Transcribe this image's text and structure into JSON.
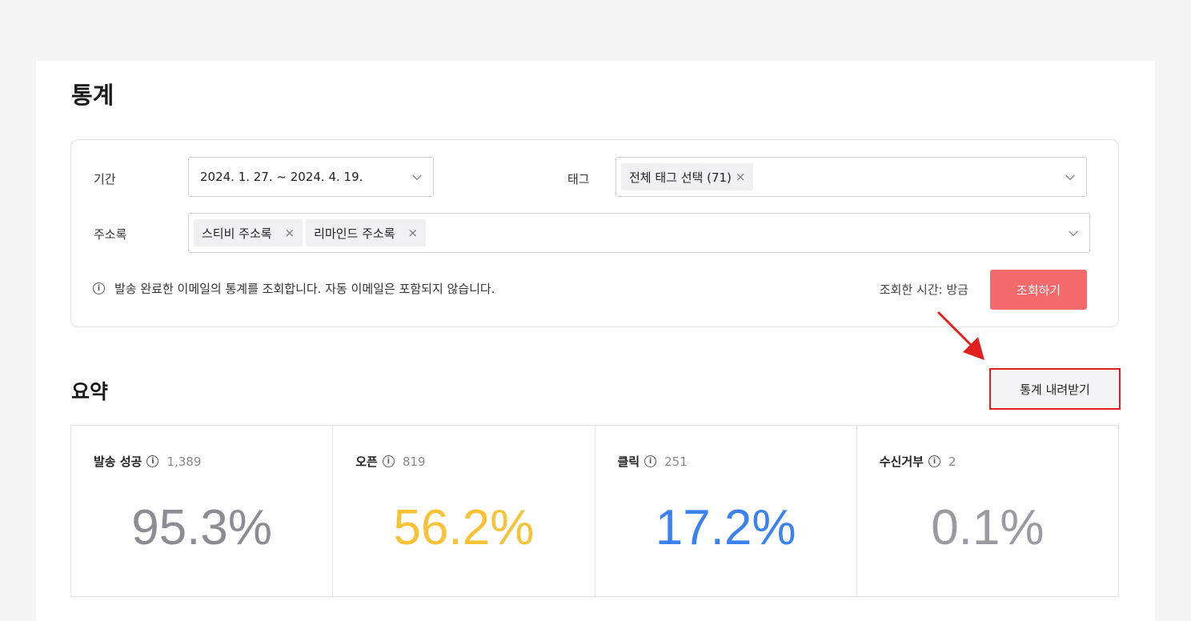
{
  "page": {
    "title": "통계"
  },
  "filters": {
    "period_label": "기간",
    "period_value": "2024. 1. 27. ~ 2024. 4. 19.",
    "tag_label": "태그",
    "tag_chips": [
      "전체 태그 선택 (71)"
    ],
    "addressbook_label": "주소록",
    "addressbook_chips": [
      "스티비 주소록",
      "리마인드 주소록"
    ],
    "chip_remove": "×",
    "info_text": "발송 완료한 이메일의 통계를 조회합니다. 자동 이메일은 포함되지 않습니다.",
    "info_icon_glyph": "i",
    "query_time": "조회한 시간: 방금",
    "query_button": "조회하기"
  },
  "summary": {
    "title": "요약",
    "download_button": "통계 내려받기",
    "stats": [
      {
        "name": "발송 성공",
        "count": "1,389",
        "value": "95.3%",
        "color": "#8c8c92"
      },
      {
        "name": "오픈",
        "count": "819",
        "value": "56.2%",
        "color": "#f7c235"
      },
      {
        "name": "클릭",
        "count": "251",
        "value": "17.2%",
        "color": "#3b82f0"
      },
      {
        "name": "수신거부",
        "count": "2",
        "value": "0.1%",
        "color": "#9a9aa0"
      }
    ]
  },
  "colors": {
    "accent": "#f56a6a",
    "annotation": "#e02020"
  },
  "icons": {
    "info": "info-icon",
    "dropdown": "chevron-down-icon",
    "remove": "close-icon",
    "annotation": "arrow-icon"
  }
}
